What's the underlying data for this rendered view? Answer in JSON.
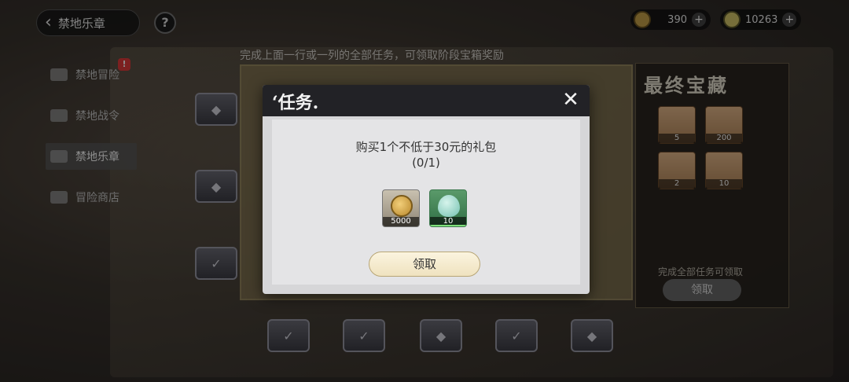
{
  "header": {
    "back_title": "禁地乐章",
    "help": "?"
  },
  "currencies": [
    {
      "icon": "coin-icon",
      "value": "390"
    },
    {
      "icon": "gem-icon",
      "value": "10263"
    }
  ],
  "sidebar": {
    "items": [
      {
        "label": "禁地冒险",
        "alert": "!"
      },
      {
        "label": "禁地战令"
      },
      {
        "label": "禁地乐章"
      },
      {
        "label": "冒险商店"
      }
    ]
  },
  "main": {
    "hint": "完成上面一行或一列的全部任务，可领取阶段宝箱奖励"
  },
  "final_panel": {
    "title": "最终宝藏",
    "rewards": [
      "5",
      "200",
      "2",
      "10"
    ],
    "note": "完成全部任务可领取",
    "claim": "领取"
  },
  "modal": {
    "title": "‘任务.",
    "close": "✕",
    "task": "购买1个不低于30元的礼包",
    "progress": "(0/1)",
    "items": [
      {
        "icon": "coin-icon",
        "count": "5000"
      },
      {
        "icon": "egg-icon",
        "count": "10"
      }
    ],
    "claim": "领取"
  }
}
